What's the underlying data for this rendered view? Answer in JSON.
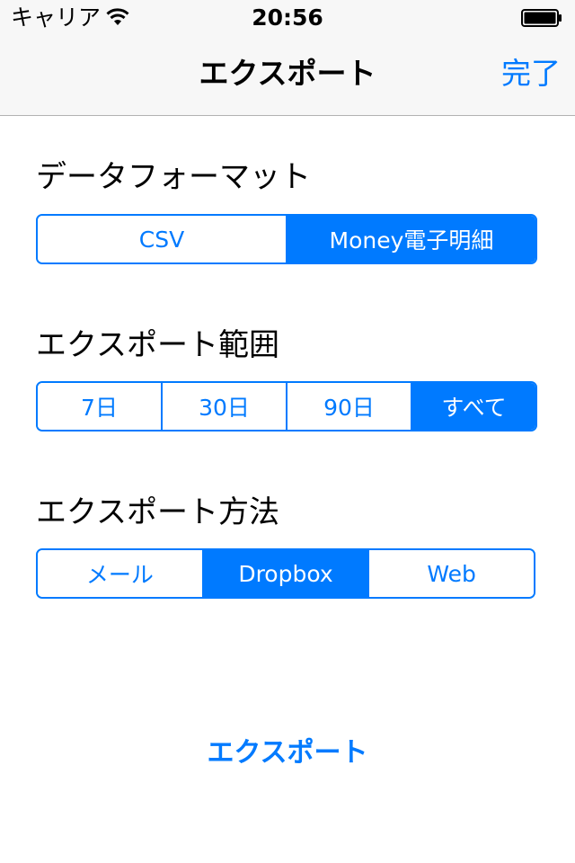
{
  "status_bar": {
    "carrier": "キャリア",
    "time": "20:56"
  },
  "nav": {
    "title": "エクスポート",
    "done_label": "完了"
  },
  "sections": [
    {
      "label": "データフォーマット",
      "options": [
        "CSV",
        "Money電子明細"
      ],
      "selected": "Money電子明細"
    },
    {
      "label": "エクスポート範囲",
      "options": [
        "7日",
        "30日",
        "90日",
        "すべて"
      ],
      "selected": "すべて"
    },
    {
      "label": "エクスポート方法",
      "options": [
        "メール",
        "Dropbox",
        "Web"
      ],
      "selected": "Dropbox"
    }
  ],
  "export_button": "エクスポート",
  "colors": {
    "accent": "#007aff",
    "nav_background": "#f7f7f7"
  }
}
